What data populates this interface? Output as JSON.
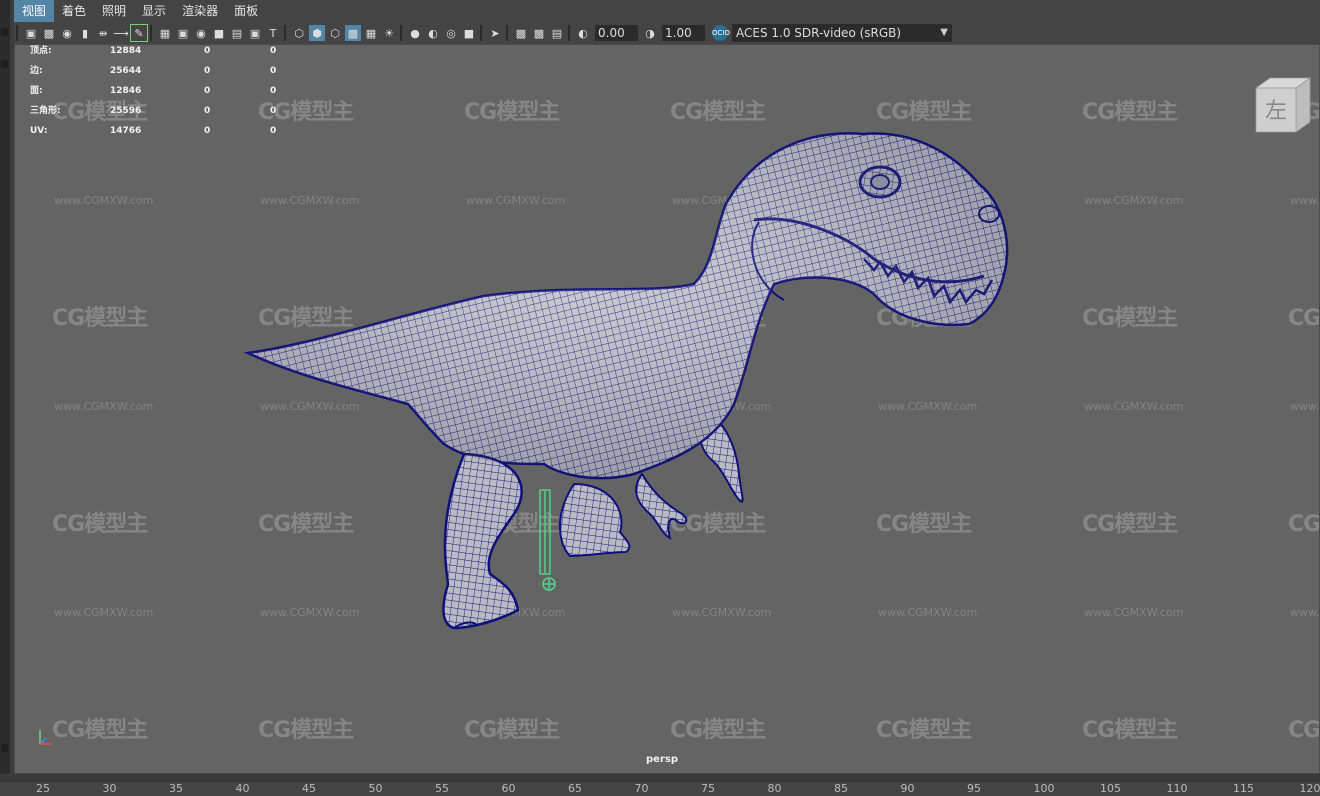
{
  "menubar": {
    "items": [
      "视图",
      "着色",
      "照明",
      "显示",
      "渲染器",
      "面板"
    ]
  },
  "toolbar": {
    "exposure_value": "0.00",
    "gamma_value": "1.00",
    "colorspace_badge": "OCIO",
    "colorspace": "ACES 1.0 SDR-video (sRGB)",
    "icons": [
      "select-camera",
      "camera-attributes",
      "bookmark",
      "image-plane",
      "2d-pan-zoom",
      "grease-pencil",
      "grid",
      "film-gate",
      "resolution-gate",
      "gate-mask",
      "field-chart",
      "safe-action",
      "safe-title",
      "wireframe",
      "smooth-shade-all",
      "wireframe-on-shaded",
      "textured",
      "use-all-lights",
      "shadows",
      "screen-space-ambient-occlusion",
      "motion-blur",
      "anti-aliasing",
      "depth-of-field",
      "isolate-select",
      "xray",
      "xray-joints",
      "xray-active-components",
      "backface-culling",
      "exposure",
      "gamma",
      "color-management"
    ]
  },
  "hud": {
    "rows": [
      {
        "label": "顶点:",
        "v1": "12884",
        "v2": "0",
        "v3": "0"
      },
      {
        "label": "边:",
        "v1": "25644",
        "v2": "0",
        "v3": "0"
      },
      {
        "label": "面:",
        "v1": "12846",
        "v2": "0",
        "v3": "0"
      },
      {
        "label": "三角形:",
        "v1": "25596",
        "v2": "0",
        "v3": "0"
      },
      {
        "label": "UV:",
        "v1": "14766",
        "v2": "0",
        "v3": "0"
      }
    ]
  },
  "viewcube": {
    "face_label": "左"
  },
  "watermark": {
    "logo": "CG模型主",
    "url": "www.CGMXW.com"
  },
  "viewport": {
    "camera": "persp"
  },
  "ruler": {
    "ticks": [
      "25",
      "30",
      "35",
      "40",
      "45",
      "50",
      "55",
      "60",
      "65",
      "70",
      "75",
      "80",
      "85",
      "90",
      "95",
      "100",
      "105",
      "110",
      "115",
      "120"
    ]
  },
  "colors": {
    "viewport_bg": "#646464",
    "menu_active": "#5285a6",
    "wire_color": "#10107a",
    "mesh_surface": "#bdbdc4",
    "joint_highlight": "#4fe38f"
  }
}
